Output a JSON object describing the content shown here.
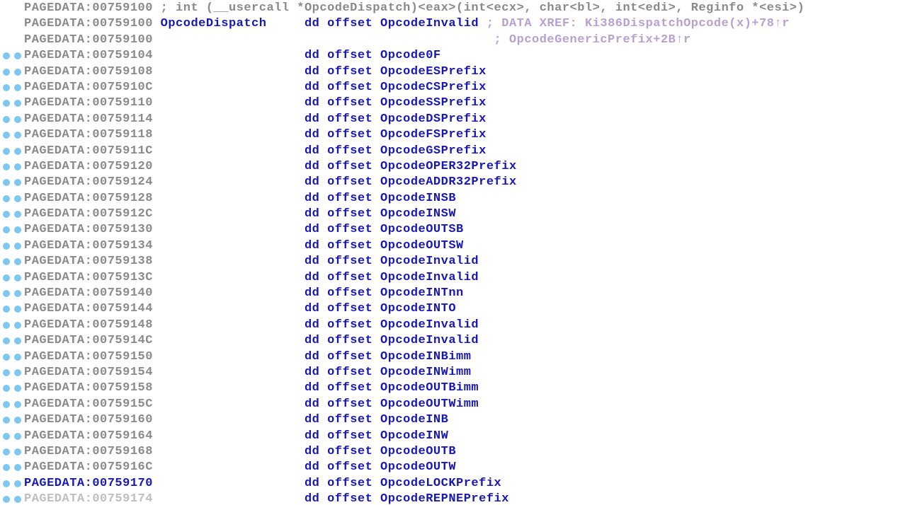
{
  "section": "PAGEDATA",
  "first_comment": "; int (__usercall *OpcodeDispatch)<eax>(int<ecx>, char<bl>, int<edi>, Reginfo *<esi>)",
  "table_label": "OpcodeDispatch",
  "dd": "dd",
  "offset": "offset",
  "xref1": "; DATA XREF: Ki386DispatchOpcode(x)+78↑r",
  "xref2": "; OpcodeGenericPrefix+2B↑r",
  "highlight_addr": "00759170",
  "rows": [
    {
      "addr": "00759100",
      "type": "comment"
    },
    {
      "addr": "00759100",
      "type": "first",
      "sym": "OpcodeInvalid"
    },
    {
      "addr": "00759100",
      "type": "xref2"
    },
    {
      "addr": "00759104",
      "type": "entry",
      "sym": "Opcode0F",
      "dot": true
    },
    {
      "addr": "00759108",
      "type": "entry",
      "sym": "OpcodeESPrefix",
      "dot": true
    },
    {
      "addr": "0075910C",
      "type": "entry",
      "sym": "OpcodeCSPrefix",
      "dot": true
    },
    {
      "addr": "00759110",
      "type": "entry",
      "sym": "OpcodeSSPrefix",
      "dot": true
    },
    {
      "addr": "00759114",
      "type": "entry",
      "sym": "OpcodeDSPrefix",
      "dot": true
    },
    {
      "addr": "00759118",
      "type": "entry",
      "sym": "OpcodeFSPrefix",
      "dot": true
    },
    {
      "addr": "0075911C",
      "type": "entry",
      "sym": "OpcodeGSPrefix",
      "dot": true
    },
    {
      "addr": "00759120",
      "type": "entry",
      "sym": "OpcodeOPER32Prefix",
      "dot": true
    },
    {
      "addr": "00759124",
      "type": "entry",
      "sym": "OpcodeADDR32Prefix",
      "dot": true
    },
    {
      "addr": "00759128",
      "type": "entry",
      "sym": "OpcodeINSB",
      "dot": true
    },
    {
      "addr": "0075912C",
      "type": "entry",
      "sym": "OpcodeINSW",
      "dot": true
    },
    {
      "addr": "00759130",
      "type": "entry",
      "sym": "OpcodeOUTSB",
      "dot": true
    },
    {
      "addr": "00759134",
      "type": "entry",
      "sym": "OpcodeOUTSW",
      "dot": true
    },
    {
      "addr": "00759138",
      "type": "entry",
      "sym": "OpcodeInvalid",
      "dot": true
    },
    {
      "addr": "0075913C",
      "type": "entry",
      "sym": "OpcodeInvalid",
      "dot": true
    },
    {
      "addr": "00759140",
      "type": "entry",
      "sym": "OpcodeINTnn",
      "dot": true
    },
    {
      "addr": "00759144",
      "type": "entry",
      "sym": "OpcodeINTO",
      "dot": true
    },
    {
      "addr": "00759148",
      "type": "entry",
      "sym": "OpcodeInvalid",
      "dot": true
    },
    {
      "addr": "0075914C",
      "type": "entry",
      "sym": "OpcodeInvalid",
      "dot": true
    },
    {
      "addr": "00759150",
      "type": "entry",
      "sym": "OpcodeINBimm",
      "dot": true
    },
    {
      "addr": "00759154",
      "type": "entry",
      "sym": "OpcodeINWimm",
      "dot": true
    },
    {
      "addr": "00759158",
      "type": "entry",
      "sym": "OpcodeOUTBimm",
      "dot": true
    },
    {
      "addr": "0075915C",
      "type": "entry",
      "sym": "OpcodeOUTWimm",
      "dot": true
    },
    {
      "addr": "00759160",
      "type": "entry",
      "sym": "OpcodeINB",
      "dot": true
    },
    {
      "addr": "00759164",
      "type": "entry",
      "sym": "OpcodeINW",
      "dot": true
    },
    {
      "addr": "00759168",
      "type": "entry",
      "sym": "OpcodeOUTB",
      "dot": true
    },
    {
      "addr": "0075916C",
      "type": "entry",
      "sym": "OpcodeOUTW",
      "dot": true
    },
    {
      "addr": "00759170",
      "type": "entry",
      "sym": "OpcodeLOCKPrefix",
      "dot": true,
      "hl": true
    },
    {
      "addr": "00759174",
      "type": "entry",
      "sym": "OpcodeREPNEPrefix",
      "dot": true,
      "cut": true
    }
  ]
}
